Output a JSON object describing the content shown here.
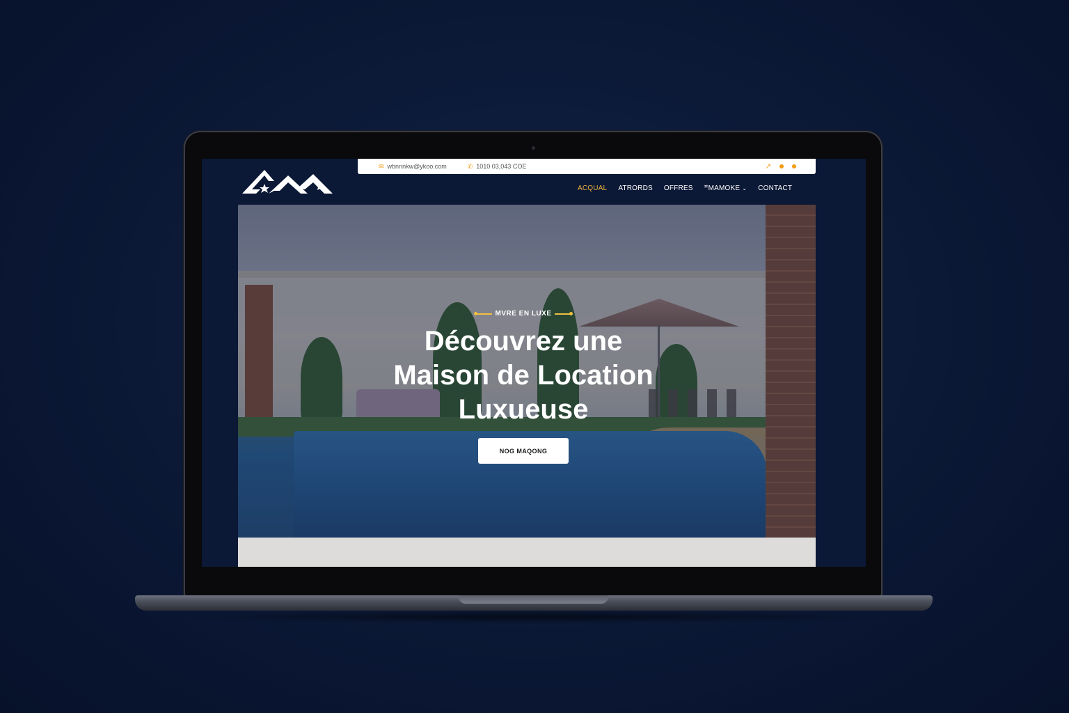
{
  "topbar": {
    "email": "wbnnnkw@ykoo.com",
    "phone": "1010 03,043 COE",
    "email_icon": "envelope-icon",
    "phone_icon": "phone-icon"
  },
  "nav": {
    "items": [
      {
        "label": "ACQUAL",
        "active": true
      },
      {
        "label": "ATRORDS",
        "active": false
      },
      {
        "label": "OFFRES",
        "active": false
      },
      {
        "label": "ꟸMAMOKE",
        "active": false
      },
      {
        "label": "CONTACT",
        "active": false
      }
    ],
    "dropdown_icon": "chevron-down-icon"
  },
  "hero": {
    "eyebrow": "MVRE EN LUXE",
    "headline_line1": "Découvrez une",
    "headline_line2": "Maison de Location",
    "headline_line3": "Luxueuse",
    "cta_label": "NOG MAQONG"
  },
  "colors": {
    "accent": "#f0b43c",
    "background": "#0b1836",
    "icon_orange": "#f39c12"
  }
}
